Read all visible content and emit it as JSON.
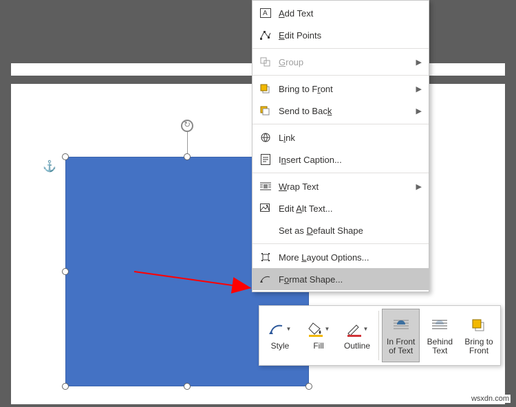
{
  "context_menu": {
    "add_text": "Add Text",
    "edit_points": "Edit Points",
    "group": "Group",
    "bring_front": "Bring to Front",
    "send_back": "Send to Back",
    "link": "Link",
    "insert_caption": "Insert Caption...",
    "wrap_text": "Wrap Text",
    "edit_alt": "Edit Alt Text...",
    "set_default": "Set as Default Shape",
    "more_layout": "More Layout Options...",
    "format_shape": "Format Shape..."
  },
  "mini_toolbar": {
    "style": "Style",
    "fill": "Fill",
    "outline": "Outline",
    "in_front": "In Front\nof Text",
    "behind": "Behind\nText",
    "bring_front": "Bring to\nFront"
  },
  "watermark": "wsxdn.com"
}
